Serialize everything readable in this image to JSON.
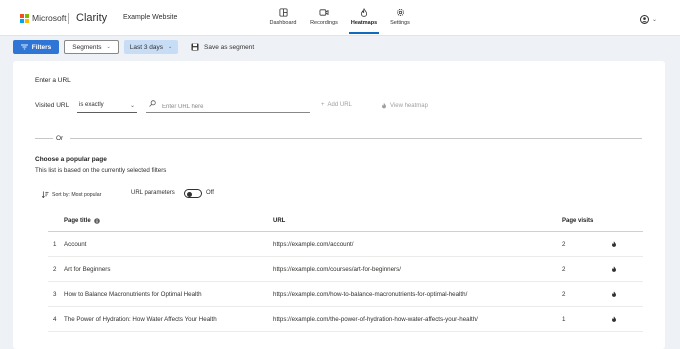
{
  "brand": {
    "company": "Microsoft",
    "product": "Clarity",
    "project": "Example Website",
    "logo_colors": [
      "#f25022",
      "#7fba00",
      "#00a4ef",
      "#ffb900"
    ]
  },
  "nav": [
    {
      "label": "Dashboard",
      "icon": "dashboard-icon",
      "active": false
    },
    {
      "label": "Recordings",
      "icon": "video-icon",
      "active": false
    },
    {
      "label": "Heatmaps",
      "icon": "flame-icon",
      "active": true
    },
    {
      "label": "Settings",
      "icon": "gear-icon",
      "active": false
    }
  ],
  "toolbar": {
    "filters_label": "Filters",
    "segments_label": "Segments",
    "date_range_label": "Last 3 days",
    "save_segment_label": "Save as segment"
  },
  "url_section": {
    "heading": "Enter a URL",
    "visited_label": "Visited URL",
    "match_type": "is exactly",
    "url_placeholder": "Enter URL here",
    "url_value": "",
    "add_url_label": "Add URL",
    "view_heatmap_label": "View heatmap"
  },
  "divider_text": "Or",
  "popular": {
    "heading": "Choose a popular page",
    "subheading": "This list is based on the currently selected filters",
    "sort_label": "Sort by: Most popular",
    "url_params_label": "URL parameters",
    "url_params_state": "Off",
    "columns": {
      "title": "Page title",
      "url": "URL",
      "visits": "Page visits"
    },
    "rows": [
      {
        "index": "1",
        "title": "Account",
        "url": "https://example.com/account/",
        "visits": "2"
      },
      {
        "index": "2",
        "title": "Art for Beginners",
        "url": "https://example.com/courses/art-for-beginners/",
        "visits": "2"
      },
      {
        "index": "3",
        "title": "How to Balance Macronutrients for Optimal Health",
        "url": "https://example.com/how-to-balance-macronutrients-for-optimal-health/",
        "visits": "2"
      },
      {
        "index": "4",
        "title": "The Power of Hydration: How Water Affects Your Health",
        "url": "https://example.com/the-power-of-hydration-how-water-affects-your-health/",
        "visits": "1"
      }
    ]
  },
  "colors": {
    "accent": "#2f75d6",
    "date_chip": "#c7dcf5",
    "page_bg": "#eef1f6"
  }
}
